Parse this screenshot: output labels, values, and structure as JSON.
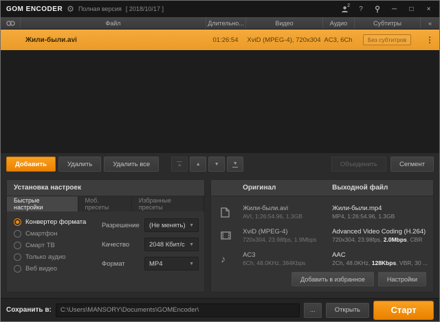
{
  "titlebar": {
    "app_name": "GOM ENCODER",
    "version_label": "Полная версия",
    "build_date": "[ 2018/10/17 ]",
    "account_badge": "2",
    "help_label": "?"
  },
  "file_table": {
    "columns": [
      "Файл",
      "Длительно...",
      "Видео",
      "Аудио",
      "Субтитры",
      "«"
    ],
    "row": {
      "file": "Жили-были.avi",
      "duration": "01:26:54",
      "video": "XviD (MPEG-4), 720x304",
      "audio": "AC3, 6Ch",
      "subtitles": "Без субтитров",
      "menu": "⋮"
    }
  },
  "toolbar": {
    "add": "Добавить",
    "remove": "Удалить",
    "remove_all": "Удалить все",
    "merge": "Объединить",
    "segment": "Сегмент"
  },
  "settings": {
    "title": "Установка настроек",
    "tabs": [
      "Быстрые настройки",
      "Моб. пресеты",
      "Избранные пресеты"
    ],
    "modes": [
      "Конвертер формата",
      "Смартфон",
      "Смарт ТВ",
      "Только аудио",
      "Веб видео"
    ],
    "selected_mode": "Конвертер формата",
    "fields": [
      {
        "label": "Разрешение",
        "value": "(Не менять)"
      },
      {
        "label": "Качество",
        "value": "2048 Кбит/с"
      },
      {
        "label": "Формат",
        "value": "MP4"
      }
    ]
  },
  "compare": {
    "original_title": "Оригинал",
    "output_title": "Выходной файл",
    "rows": [
      {
        "orig_name": "Жили-были.avi",
        "orig_info": "AVI, 1:26:54.96, 1.3GB",
        "out_name": "Жили-были.mp4",
        "out_pre": "MP4, 1:26:54.96, 1.3GB",
        "out_em": "",
        "out_post": ""
      },
      {
        "orig_name": "XviD (MPEG-4)",
        "orig_info": "720x304, 23.98fps, 1.9Mbps",
        "out_name": "Advanced Video Coding (H.264)",
        "out_pre": "720x304, 23.98fps, ",
        "out_em": "2.0Mbps",
        "out_post": ", CBR"
      },
      {
        "orig_name": "AC3",
        "orig_info": "6Ch, 48.0KHz, 384Kbps",
        "out_name": "AAC",
        "out_pre": "2Ch, 48.0KHz, ",
        "out_em": "128Kbps",
        "out_post": ", VBR, 30 ..."
      }
    ],
    "favorite_button": "Добавить в избранное",
    "settings_button": "Настройки"
  },
  "bottom": {
    "save_label": "Сохранить в:",
    "path": "C:\\Users\\MANSORY\\Documents\\GOMEncoder\\",
    "browse": "...",
    "open": "Открыть",
    "start": "Старт"
  },
  "colors": {
    "accent": "#f08a00",
    "selected_row": "#f2a137"
  }
}
